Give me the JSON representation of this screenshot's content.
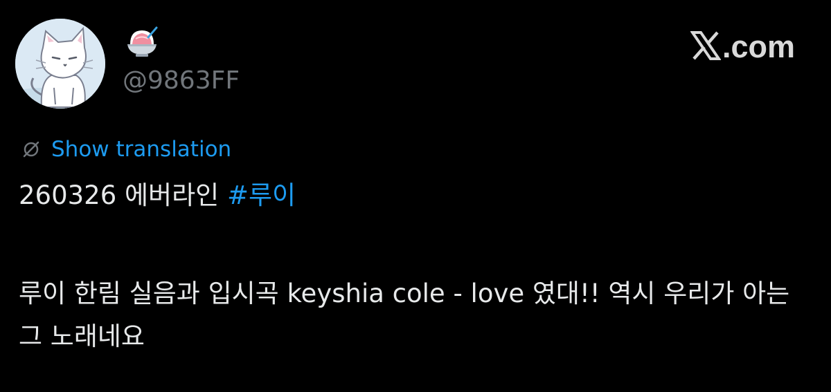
{
  "header": {
    "display_emoji": "shaved-ice-emoji",
    "handle": "@9863FF",
    "logo_text": ".com"
  },
  "translation": {
    "label": "Show translation",
    "icon": "globe-slash-icon"
  },
  "post": {
    "line1_text": "260326 에버라인 ",
    "hashtag": "#루이",
    "body": "루이 한림 실음과 입시곡 keyshia cole - love 였대!! 역시 우리가 아는 그 노래네요"
  },
  "colors": {
    "background": "#000000",
    "text": "#e7e9ea",
    "secondary_text": "#71767b",
    "link": "#1d9bf0"
  }
}
